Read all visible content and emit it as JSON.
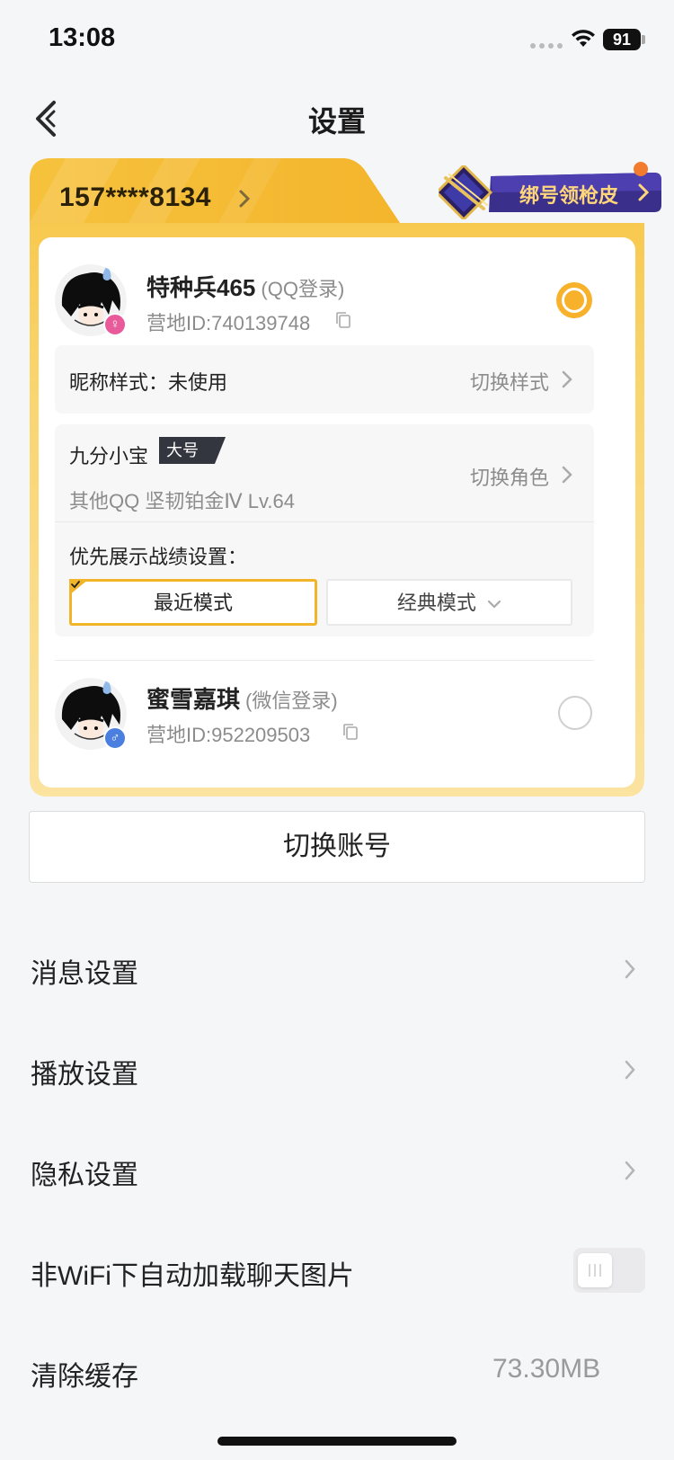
{
  "status_bar": {
    "time": "13:08",
    "battery": "91"
  },
  "header": {
    "title": "设置"
  },
  "account_card": {
    "phone": "157****8134",
    "promo_label": "绑号领枪皮",
    "accounts": [
      {
        "name": "特种兵465",
        "login_type": "(QQ登录)",
        "id_text": "营地ID:740139748",
        "selected": true,
        "gender": "female",
        "gender_color": "#e85a9a"
      },
      {
        "name": "蜜雪嘉琪",
        "login_type": "(微信登录)",
        "id_text": "营地ID:952209503",
        "selected": false,
        "gender": "male",
        "gender_color": "#4a7fe0"
      }
    ],
    "nickname_style": {
      "label": "昵称样式：未使用",
      "action": "切换样式"
    },
    "role": {
      "name": "九分小宝",
      "tag": "大号",
      "detail": "其他QQ  坚韧铂金Ⅳ  Lv.64",
      "action": "切换角色"
    },
    "record_display": {
      "label": "优先展示战绩设置：",
      "modes": [
        "最近模式",
        "经典模式"
      ],
      "active_mode": "最近模式"
    }
  },
  "switch_account_label": "切换账号",
  "settings": [
    {
      "label": "消息设置",
      "type": "link"
    },
    {
      "label": "播放设置",
      "type": "link"
    },
    {
      "label": "隐私设置",
      "type": "link"
    },
    {
      "label": "非WiFi下自动加载聊天图片",
      "type": "toggle",
      "on": false
    },
    {
      "label": "清除缓存",
      "type": "value",
      "value": "73.30MB"
    }
  ],
  "colors": {
    "accent": "#f7b12b",
    "card_gold": "#f6c33e",
    "page_bg": "#f5f6f8"
  }
}
